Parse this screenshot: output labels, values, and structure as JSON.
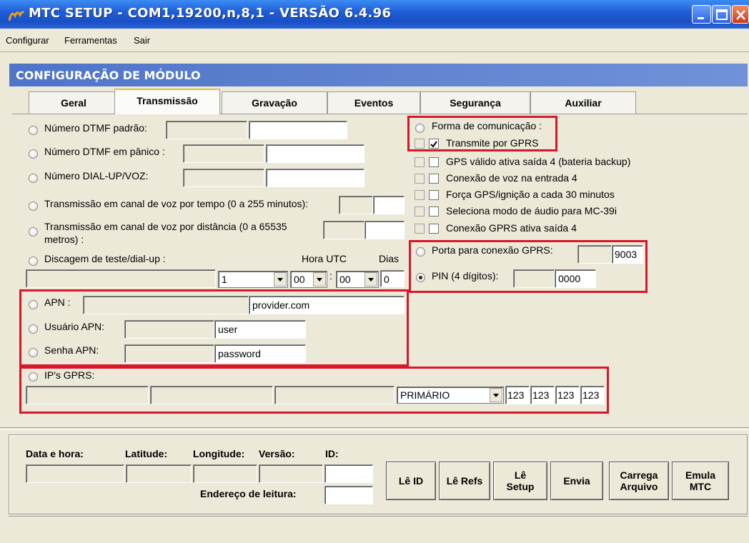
{
  "window": {
    "title": "MTC SETUP - COM1,19200,n,8,1 - VERSÃO 6.4.96"
  },
  "menu": [
    "Configurar",
    "Ferramentas",
    "Sair"
  ],
  "header": {
    "title": "CONFIGURAÇÃO DE MÓDULO"
  },
  "tabs": [
    {
      "label": "Geral",
      "active": false
    },
    {
      "label": "Transmissão",
      "active": true
    },
    {
      "label": "Gravação",
      "active": false
    },
    {
      "label": "Eventos",
      "active": false
    },
    {
      "label": "Segurança",
      "active": false
    },
    {
      "label": "Auxiliar",
      "active": false
    }
  ],
  "left": {
    "dtmf_padrao": "Número DTMF padrão:",
    "dtmf_panico": "Número DTMF em pânico :",
    "dial_up": "Número DIAL-UP/VOZ:",
    "canal_tempo": "Transmissão em canal de voz por tempo (0 a 255 minutos):",
    "canal_dist_1": "Transmissão em canal de voz por distância (0 a 65535",
    "canal_dist_2": "metros) :",
    "discagem": "Discagem de teste/dial-up :",
    "hora_utc": "Hora UTC",
    "dias": "Dias",
    "discagem_combo1": "1",
    "discagem_hour": "00",
    "discagem_min": "00",
    "discagem_dias": "0",
    "apn_label": "APN :",
    "apn_value": "provider.com",
    "user_label": "Usuário APN:",
    "user_value": "user",
    "pass_label": "Senha APN:",
    "pass_value": "password",
    "ips_label": "IP's GPRS:",
    "ips_combo": "PRIMÁRIO",
    "ip_octets": [
      "123",
      "123",
      "123",
      "123"
    ]
  },
  "right": {
    "forma": "Forma de comunicação :",
    "checks": [
      {
        "label": "Transmite por GPRS",
        "checked": true
      },
      {
        "label": "GPS válido ativa saída 4 (bateria backup)",
        "checked": false
      },
      {
        "label": "Conexão de voz na entrada 4",
        "checked": false
      },
      {
        "label": "Força GPS/ignição a cada 30 minutos",
        "checked": false
      },
      {
        "label": "Seleciona modo de áudio para MC-39i",
        "checked": false
      },
      {
        "label": "Conexão GPRS ativa saída 4",
        "checked": false
      }
    ],
    "porta_label": "Porta para conexão GPRS:",
    "porta_value": "9003",
    "pin_label": "PIN  (4 dígitos):",
    "pin_value": "0000"
  },
  "bottom": {
    "data_hora": "Data e hora:",
    "latitude": "Latitude:",
    "longitude": "Longitude:",
    "versao": "Versão:",
    "id": "ID:",
    "endereco": "Endereço de leitura:",
    "buttons": {
      "le_id": "Lê ID",
      "le_refs": "Lê Refs",
      "le_setup_1": "Lê",
      "le_setup_2": "Setup",
      "envia": "Envia",
      "carrega_1": "Carrega",
      "carrega_2": "Arquivo",
      "emula_1": "Emula",
      "emula_2": "MTC"
    }
  }
}
